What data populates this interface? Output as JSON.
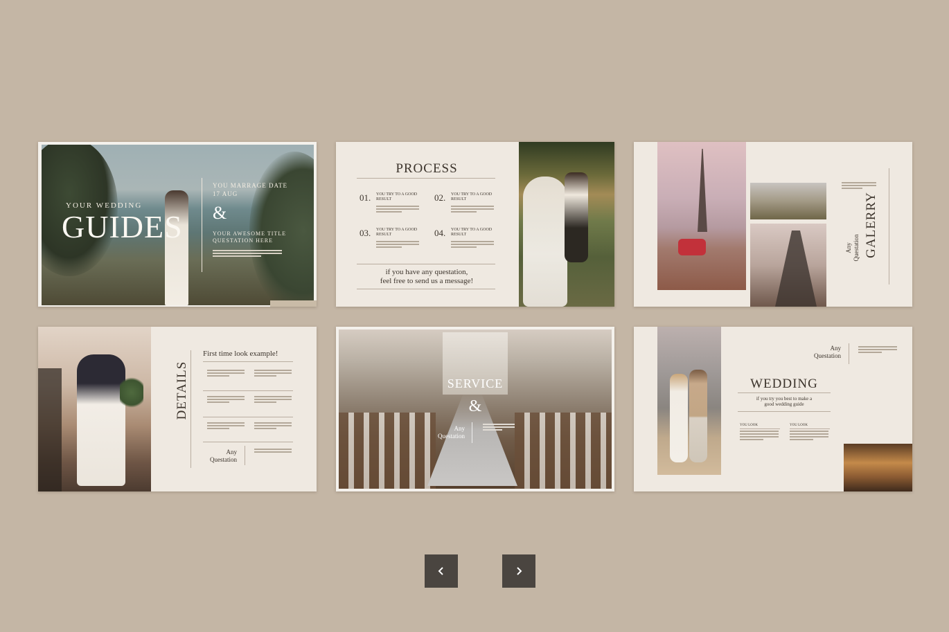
{
  "slides": {
    "guides": {
      "small_title": "YOUR WEDDING",
      "big_title": "GUIDES",
      "amp": "&",
      "right_line1": "YOU MARRAGE DATE",
      "right_line2": "17 AUG",
      "right_lines": "YOUR AWESOME TITLE QUESTATION HERE"
    },
    "process": {
      "title": "PROCESS",
      "steps": [
        {
          "num": "01.",
          "title": "YOU TRY TO A GOOD RESULT"
        },
        {
          "num": "02.",
          "title": "YOU TRY TO A GOOD RESULT"
        },
        {
          "num": "03.",
          "title": "YOU TRY TO A GOOD RESULT"
        },
        {
          "num": "04.",
          "title": "YOU TRY TO A GOOD RESULT"
        }
      ],
      "footer_line1": "if you have any questation,",
      "footer_line2": "feel free to send us a message!"
    },
    "gallery": {
      "title": "GALERRY",
      "any": "Any",
      "questation": "Questation"
    },
    "details": {
      "title": "DETAILS",
      "heading": "First time look example!",
      "any": "Any",
      "questation": "Questation"
    },
    "service": {
      "title": "SERVICE",
      "amp": "&",
      "any": "Any",
      "questation": "Questation"
    },
    "wedding": {
      "title": "WEDDING",
      "subtitle_line1": "if you try you best to make a",
      "subtitle_line2": "good wedding guide",
      "any": "Any",
      "questation": "Questation",
      "col1_label": "YOU LOOK",
      "col2_label": "YOU LOOK"
    }
  },
  "nav": {
    "prev_icon": "chevron-left-icon",
    "next_icon": "chevron-right-icon"
  },
  "colors": {
    "background": "#c4b6a5",
    "slide": "#efe9e1",
    "button": "#4a4540"
  }
}
